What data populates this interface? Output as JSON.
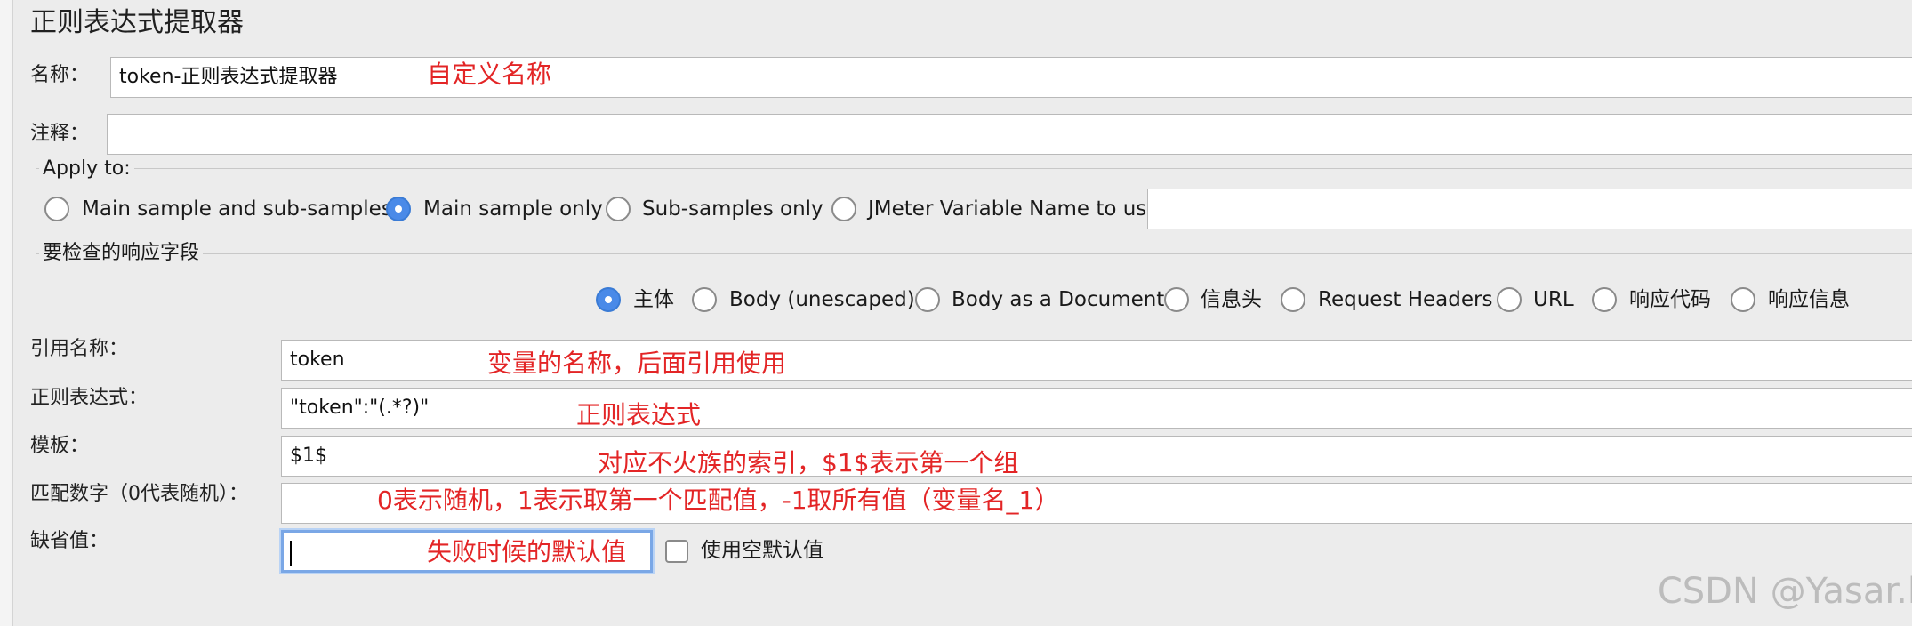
{
  "panel": {
    "title": "正则表达式提取器"
  },
  "name_row": {
    "label": "名称：",
    "value": "token-正则表达式提取器",
    "annotation": "自定义名称"
  },
  "comment_row": {
    "label": "注释：",
    "value": ""
  },
  "apply_to": {
    "title": "Apply to:",
    "options": [
      {
        "label": "Main sample and sub-samples",
        "checked": false
      },
      {
        "label": "Main sample only",
        "checked": true
      },
      {
        "label": "Sub-samples only",
        "checked": false
      },
      {
        "label": "JMeter Variable Name to use",
        "checked": false
      }
    ],
    "variable_value": ""
  },
  "response_field": {
    "title": "要检查的响应字段",
    "options": [
      {
        "label": "主体",
        "checked": true
      },
      {
        "label": "Body (unescaped)",
        "checked": false
      },
      {
        "label": "Body as a Document",
        "checked": false
      },
      {
        "label": "信息头",
        "checked": false
      },
      {
        "label": "Request Headers",
        "checked": false
      },
      {
        "label": "URL",
        "checked": false
      },
      {
        "label": "响应代码",
        "checked": false
      },
      {
        "label": "响应信息",
        "checked": false
      }
    ]
  },
  "fields": {
    "ref_name": {
      "label": "引用名称：",
      "value": "token",
      "annotation": "变量的名称，后面引用使用"
    },
    "regex": {
      "label": "正则表达式：",
      "value": "\"token\":\"(.*?)\"",
      "annotation": "正则表达式"
    },
    "template": {
      "label": "模板：",
      "value": "$1$",
      "annotation": "对应不火族的索引，$1$表示第一个组"
    },
    "match_no": {
      "label": "匹配数字（0代表随机）：",
      "value": "",
      "annotation": "0表示随机，1表示取第一个匹配值，-1取所有值（变量名_1）"
    },
    "default": {
      "label": "缺省值：",
      "value": "",
      "annotation": "失败时候的默认值",
      "empty_default_label": "使用空默认值",
      "empty_default_checked": false
    }
  },
  "watermark": "CSDN @Yasar.l",
  "colors": {
    "annotation": "#e32526",
    "radio_checked": "#4a8ae8",
    "background": "#ececec"
  }
}
